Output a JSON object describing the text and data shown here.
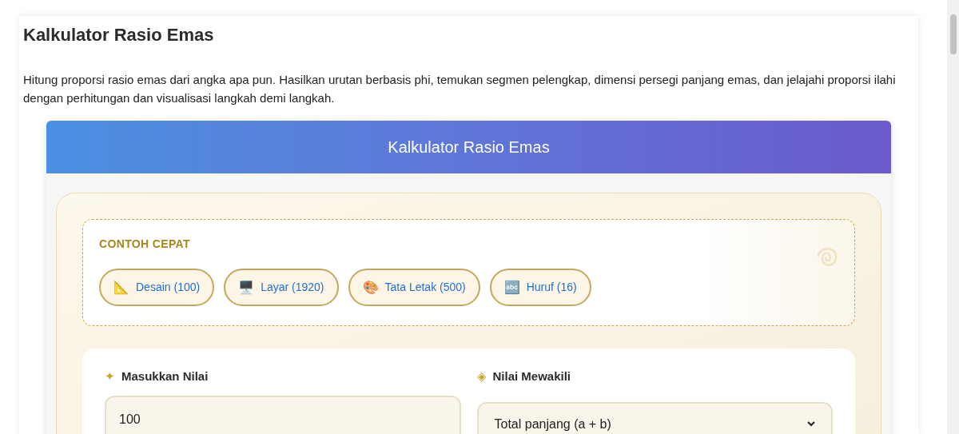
{
  "page": {
    "title": "Kalkulator Rasio Emas",
    "description": "Hitung proporsi rasio emas dari angka apa pun. Hasilkan urutan berbasis phi, temukan segmen pelengkap, dimensi persegi panjang emas, dan jelajahi proporsi ilahi dengan perhitungan dan visualisasi langkah demi langkah."
  },
  "calculator": {
    "header": "Kalkulator Rasio Emas",
    "quick_examples": {
      "heading": "CONTOH CEPAT",
      "items": [
        {
          "emoji": "📐",
          "label": "Desain (100)"
        },
        {
          "emoji": "🖥️",
          "label": "Layar (1920)"
        },
        {
          "emoji": "🎨",
          "label": "Tata Letak (500)"
        },
        {
          "emoji": "🔤",
          "label": "Huruf (16)"
        }
      ]
    },
    "input": {
      "symbol": "✦",
      "label": "Masukkan Nilai",
      "value": "100"
    },
    "represents": {
      "symbol": "◈",
      "label": "Nilai Mewakili",
      "value": "Total panjang (a + b)"
    }
  }
}
